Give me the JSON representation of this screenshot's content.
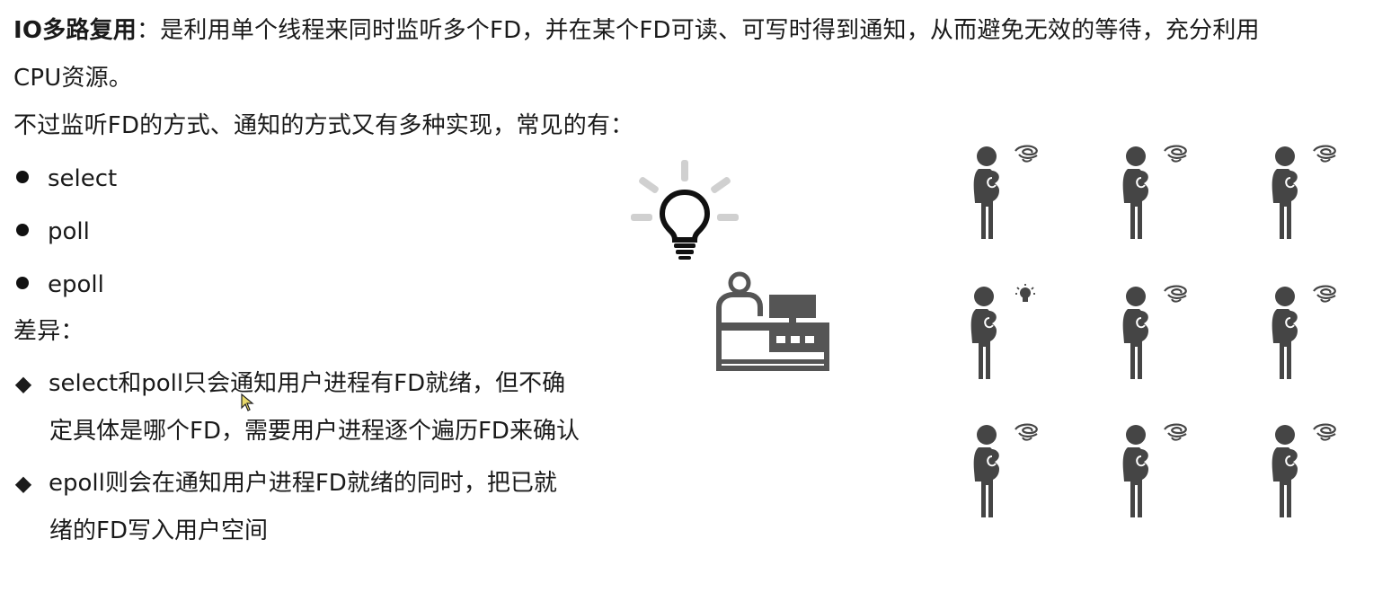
{
  "intro": {
    "term": "IO多路复用",
    "line1_rest": "：是利用单个线程来同时监听多个FD，并在某个FD可读、可写时得到通知，从而避免无效的等待，充分利用",
    "line2": "CPU资源。",
    "line3": "不过监听FD的方式、通知的方式又有多种实现，常见的有："
  },
  "implementations": [
    "select",
    "poll",
    "epoll"
  ],
  "differences": {
    "heading": "差异：",
    "items": [
      {
        "line1": "select和poll只会通知用户进程有FD就绪，但不确",
        "line2": "定具体是哪个FD，需要用户进程逐个遍历FD来确认"
      },
      {
        "line1": "epoll则会在通知用户进程FD就绪的同时，把已就",
        "line2": "绪的FD写入用户空间"
      }
    ]
  },
  "illustration": {
    "icons": [
      "lightbulb-icon",
      "cashier-desk-icon",
      "confused-person-icon",
      "idea-person-icon"
    ],
    "person_states": [
      [
        "confused",
        "confused",
        "confused"
      ],
      [
        "idea",
        "confused",
        "confused"
      ],
      [
        "confused",
        "confused",
        "confused"
      ]
    ],
    "figure_color": "#454545",
    "ray_color": "#d0d0d0"
  }
}
